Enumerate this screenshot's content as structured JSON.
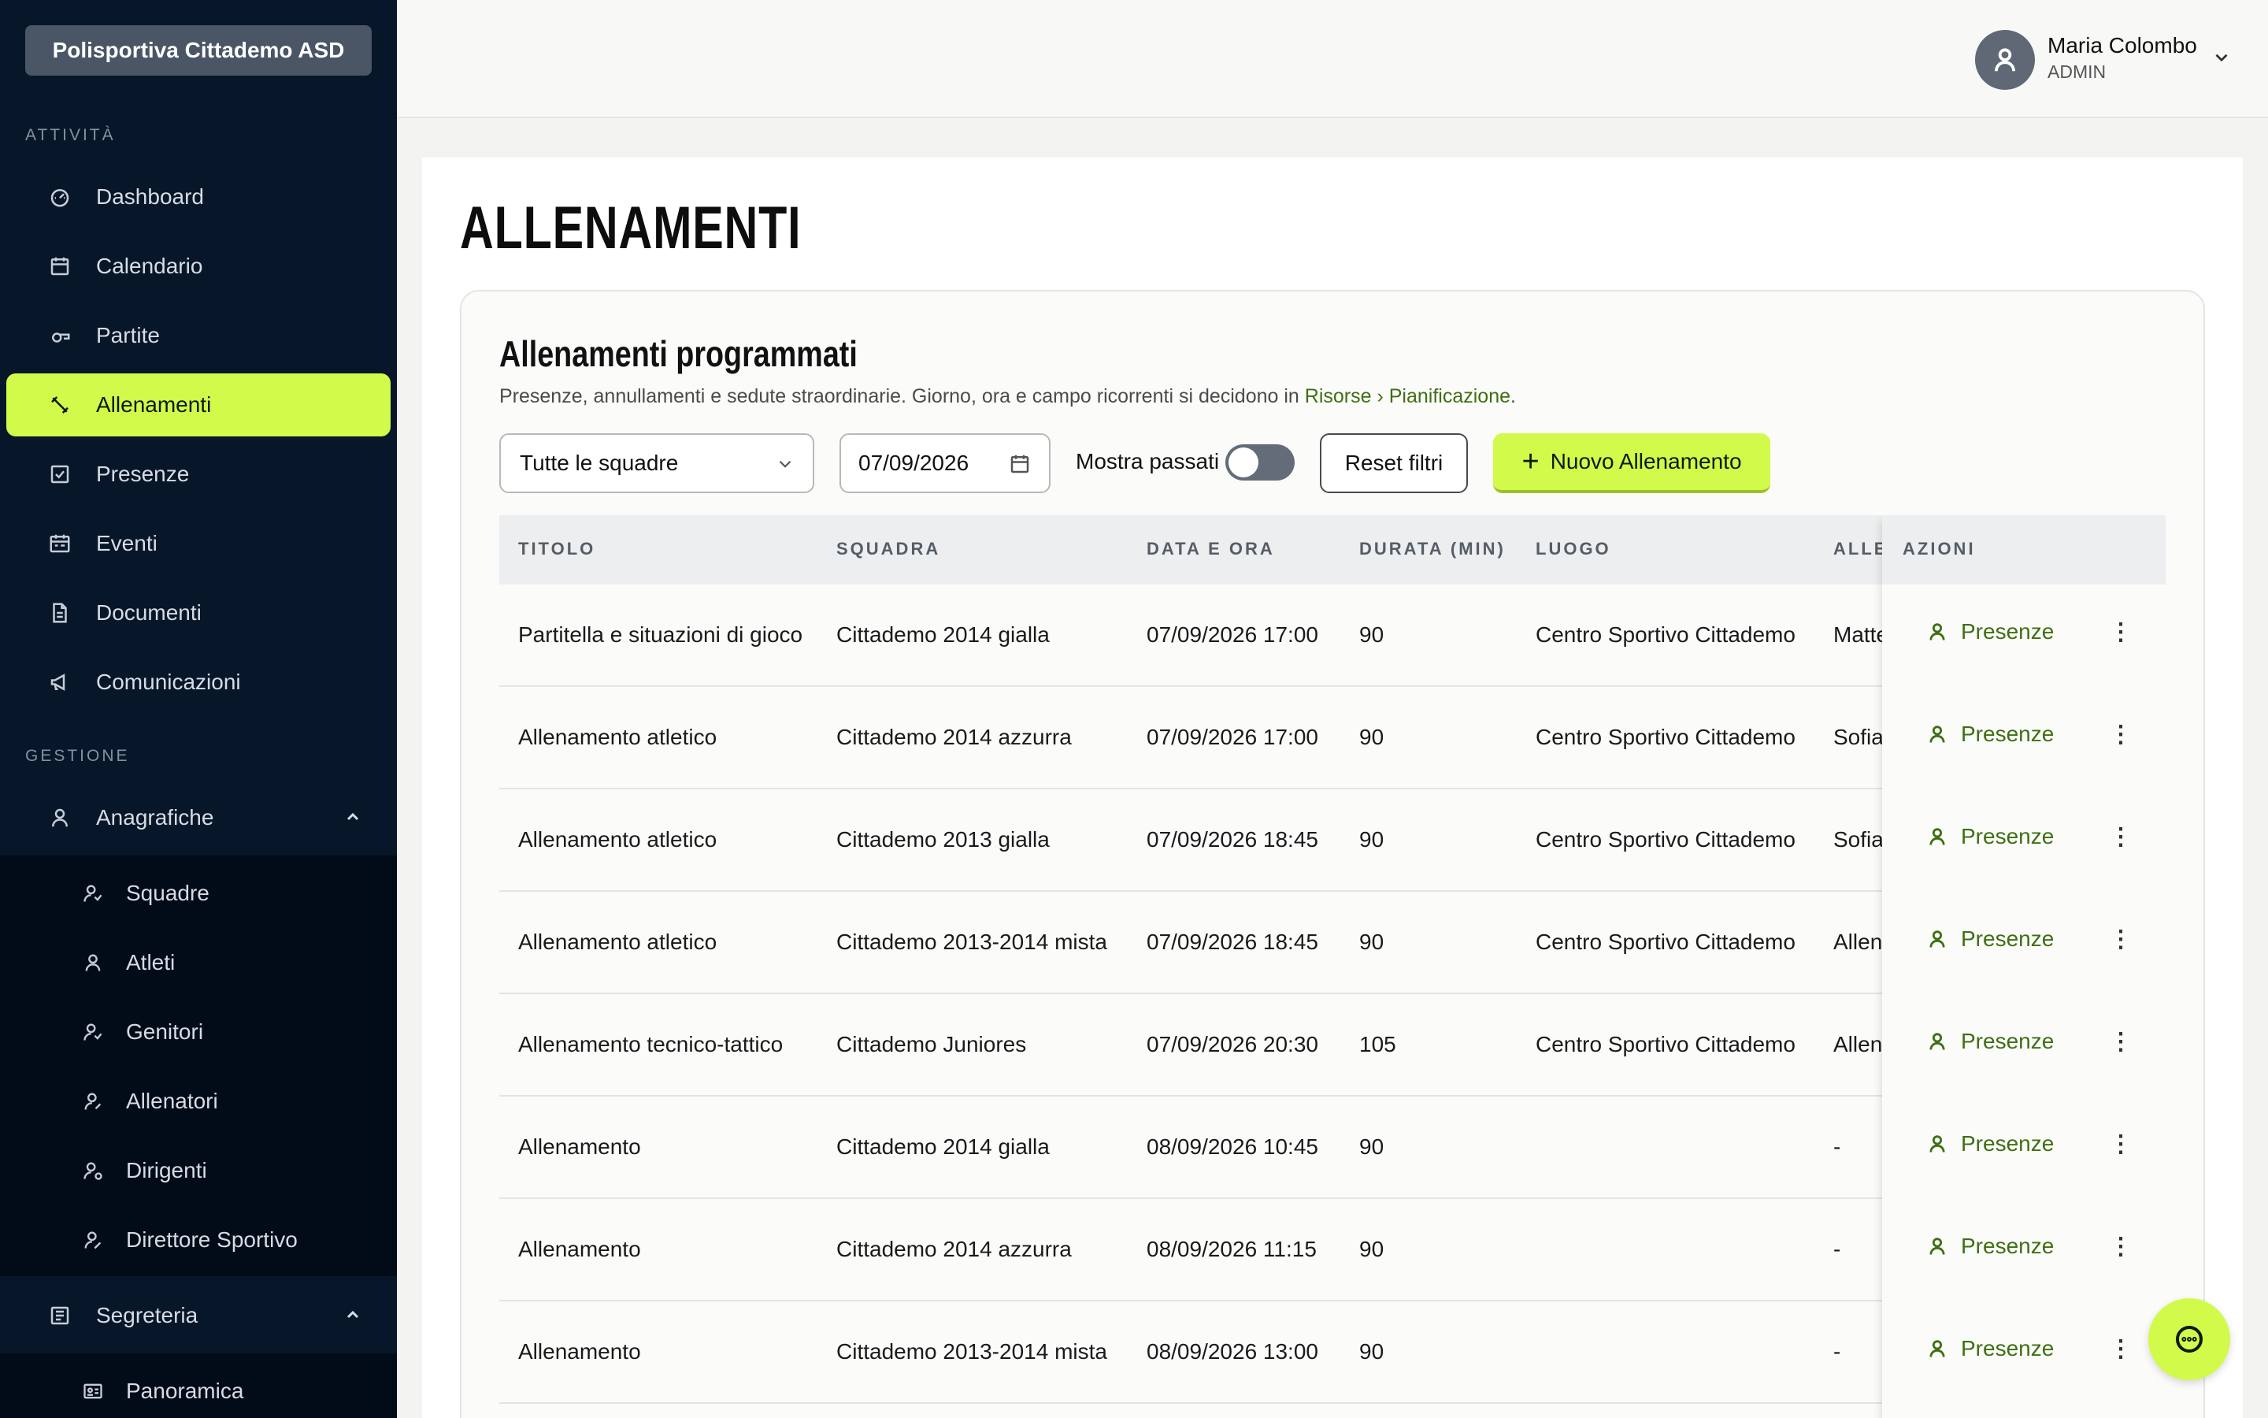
{
  "org": {
    "name": "Polisportiva Cittademo ASD"
  },
  "sidebar": {
    "section_activity": "ATTIVITÀ",
    "activity_items": [
      {
        "label": "Dashboard",
        "icon": "gauge-icon"
      },
      {
        "label": "Calendario",
        "icon": "calendar-icon"
      },
      {
        "label": "Partite",
        "icon": "whistle-icon"
      },
      {
        "label": "Allenamenti",
        "icon": "dumbbell-icon",
        "active": true
      },
      {
        "label": "Presenze",
        "icon": "checkbox-icon"
      },
      {
        "label": "Eventi",
        "icon": "calendar-event-icon"
      },
      {
        "label": "Documenti",
        "icon": "document-icon"
      },
      {
        "label": "Comunicazioni",
        "icon": "megaphone-icon"
      }
    ],
    "section_management": "GESTIONE",
    "anagrafiche": {
      "label": "Anagrafiche",
      "icon": "user-icon",
      "items": [
        {
          "label": "Squadre",
          "icon": "users-icon"
        },
        {
          "label": "Atleti",
          "icon": "user-icon"
        },
        {
          "label": "Genitori",
          "icon": "users-icon"
        },
        {
          "label": "Allenatori",
          "icon": "user-edit-icon"
        },
        {
          "label": "Dirigenti",
          "icon": "user-cog-icon"
        },
        {
          "label": "Direttore Sportivo",
          "icon": "user-edit-icon"
        }
      ]
    },
    "segreteria": {
      "label": "Segreteria",
      "icon": "newspaper-icon",
      "items": [
        {
          "label": "Panoramica",
          "icon": "id-card-icon"
        }
      ]
    }
  },
  "user": {
    "name": "Maria Colombo",
    "role": "ADMIN"
  },
  "page": {
    "title": "ALLENAMENTI"
  },
  "card": {
    "title": "Allenamenti programmati",
    "subtitle_text": "Presenze, annullamenti e sedute straordinarie. Giorno, ora e campo ricorrenti si decidono in ",
    "subtitle_link": "Risorse › Pianificazione",
    "subtitle_end": "."
  },
  "filters": {
    "team_select": "Tutte le squadre",
    "date_value": "07/09/2026",
    "show_past_label": "Mostra passati",
    "show_past": false,
    "reset_label": "Reset filtri",
    "new_label": "Nuovo Allenamento"
  },
  "table": {
    "columns": [
      "TITOLO",
      "SQUADRA",
      "DATA E ORA",
      "DURATA (MIN)",
      "LUOGO",
      "ALLENATORE",
      "AZIONI"
    ],
    "action_label": "Presenze",
    "rows": [
      {
        "titolo": "Partitella e situazioni di gioco",
        "squadra": "Cittademo 2014 gialla",
        "data": "07/09/2026 17:00",
        "durata": "90",
        "luogo": "Centro Sportivo Cittademo",
        "allenatore": "Matteo"
      },
      {
        "titolo": "Allenamento atletico",
        "squadra": "Cittademo 2014 azzurra",
        "data": "07/09/2026 17:00",
        "durata": "90",
        "luogo": "Centro Sportivo Cittademo",
        "allenatore": "Sofia"
      },
      {
        "titolo": "Allenamento atletico",
        "squadra": "Cittademo 2013 gialla",
        "data": "07/09/2026 18:45",
        "durata": "90",
        "luogo": "Centro Sportivo Cittademo",
        "allenatore": "Sofia"
      },
      {
        "titolo": "Allenamento atletico",
        "squadra": "Cittademo 2013-2014 mista",
        "data": "07/09/2026 18:45",
        "durata": "90",
        "luogo": "Centro Sportivo Cittademo",
        "allenatore": "Allenatore"
      },
      {
        "titolo": "Allenamento tecnico-tattico",
        "squadra": "Cittademo Juniores",
        "data": "07/09/2026 20:30",
        "durata": "105",
        "luogo": "Centro Sportivo Cittademo",
        "allenatore": "Allenatore"
      },
      {
        "titolo": "Allenamento",
        "squadra": "Cittademo 2014 gialla",
        "data": "08/09/2026 10:45",
        "durata": "90",
        "luogo": "",
        "allenatore": "-"
      },
      {
        "titolo": "Allenamento",
        "squadra": "Cittademo 2014 azzurra",
        "data": "08/09/2026 11:15",
        "durata": "90",
        "luogo": "",
        "allenatore": "-"
      },
      {
        "titolo": "Allenamento",
        "squadra": "Cittademo 2013-2014 mista",
        "data": "08/09/2026 13:00",
        "durata": "90",
        "luogo": "",
        "allenatore": "-"
      }
    ]
  },
  "colors": {
    "accent": "#d2fa4a",
    "sidebar": "#071629",
    "link": "#3f6f12"
  }
}
